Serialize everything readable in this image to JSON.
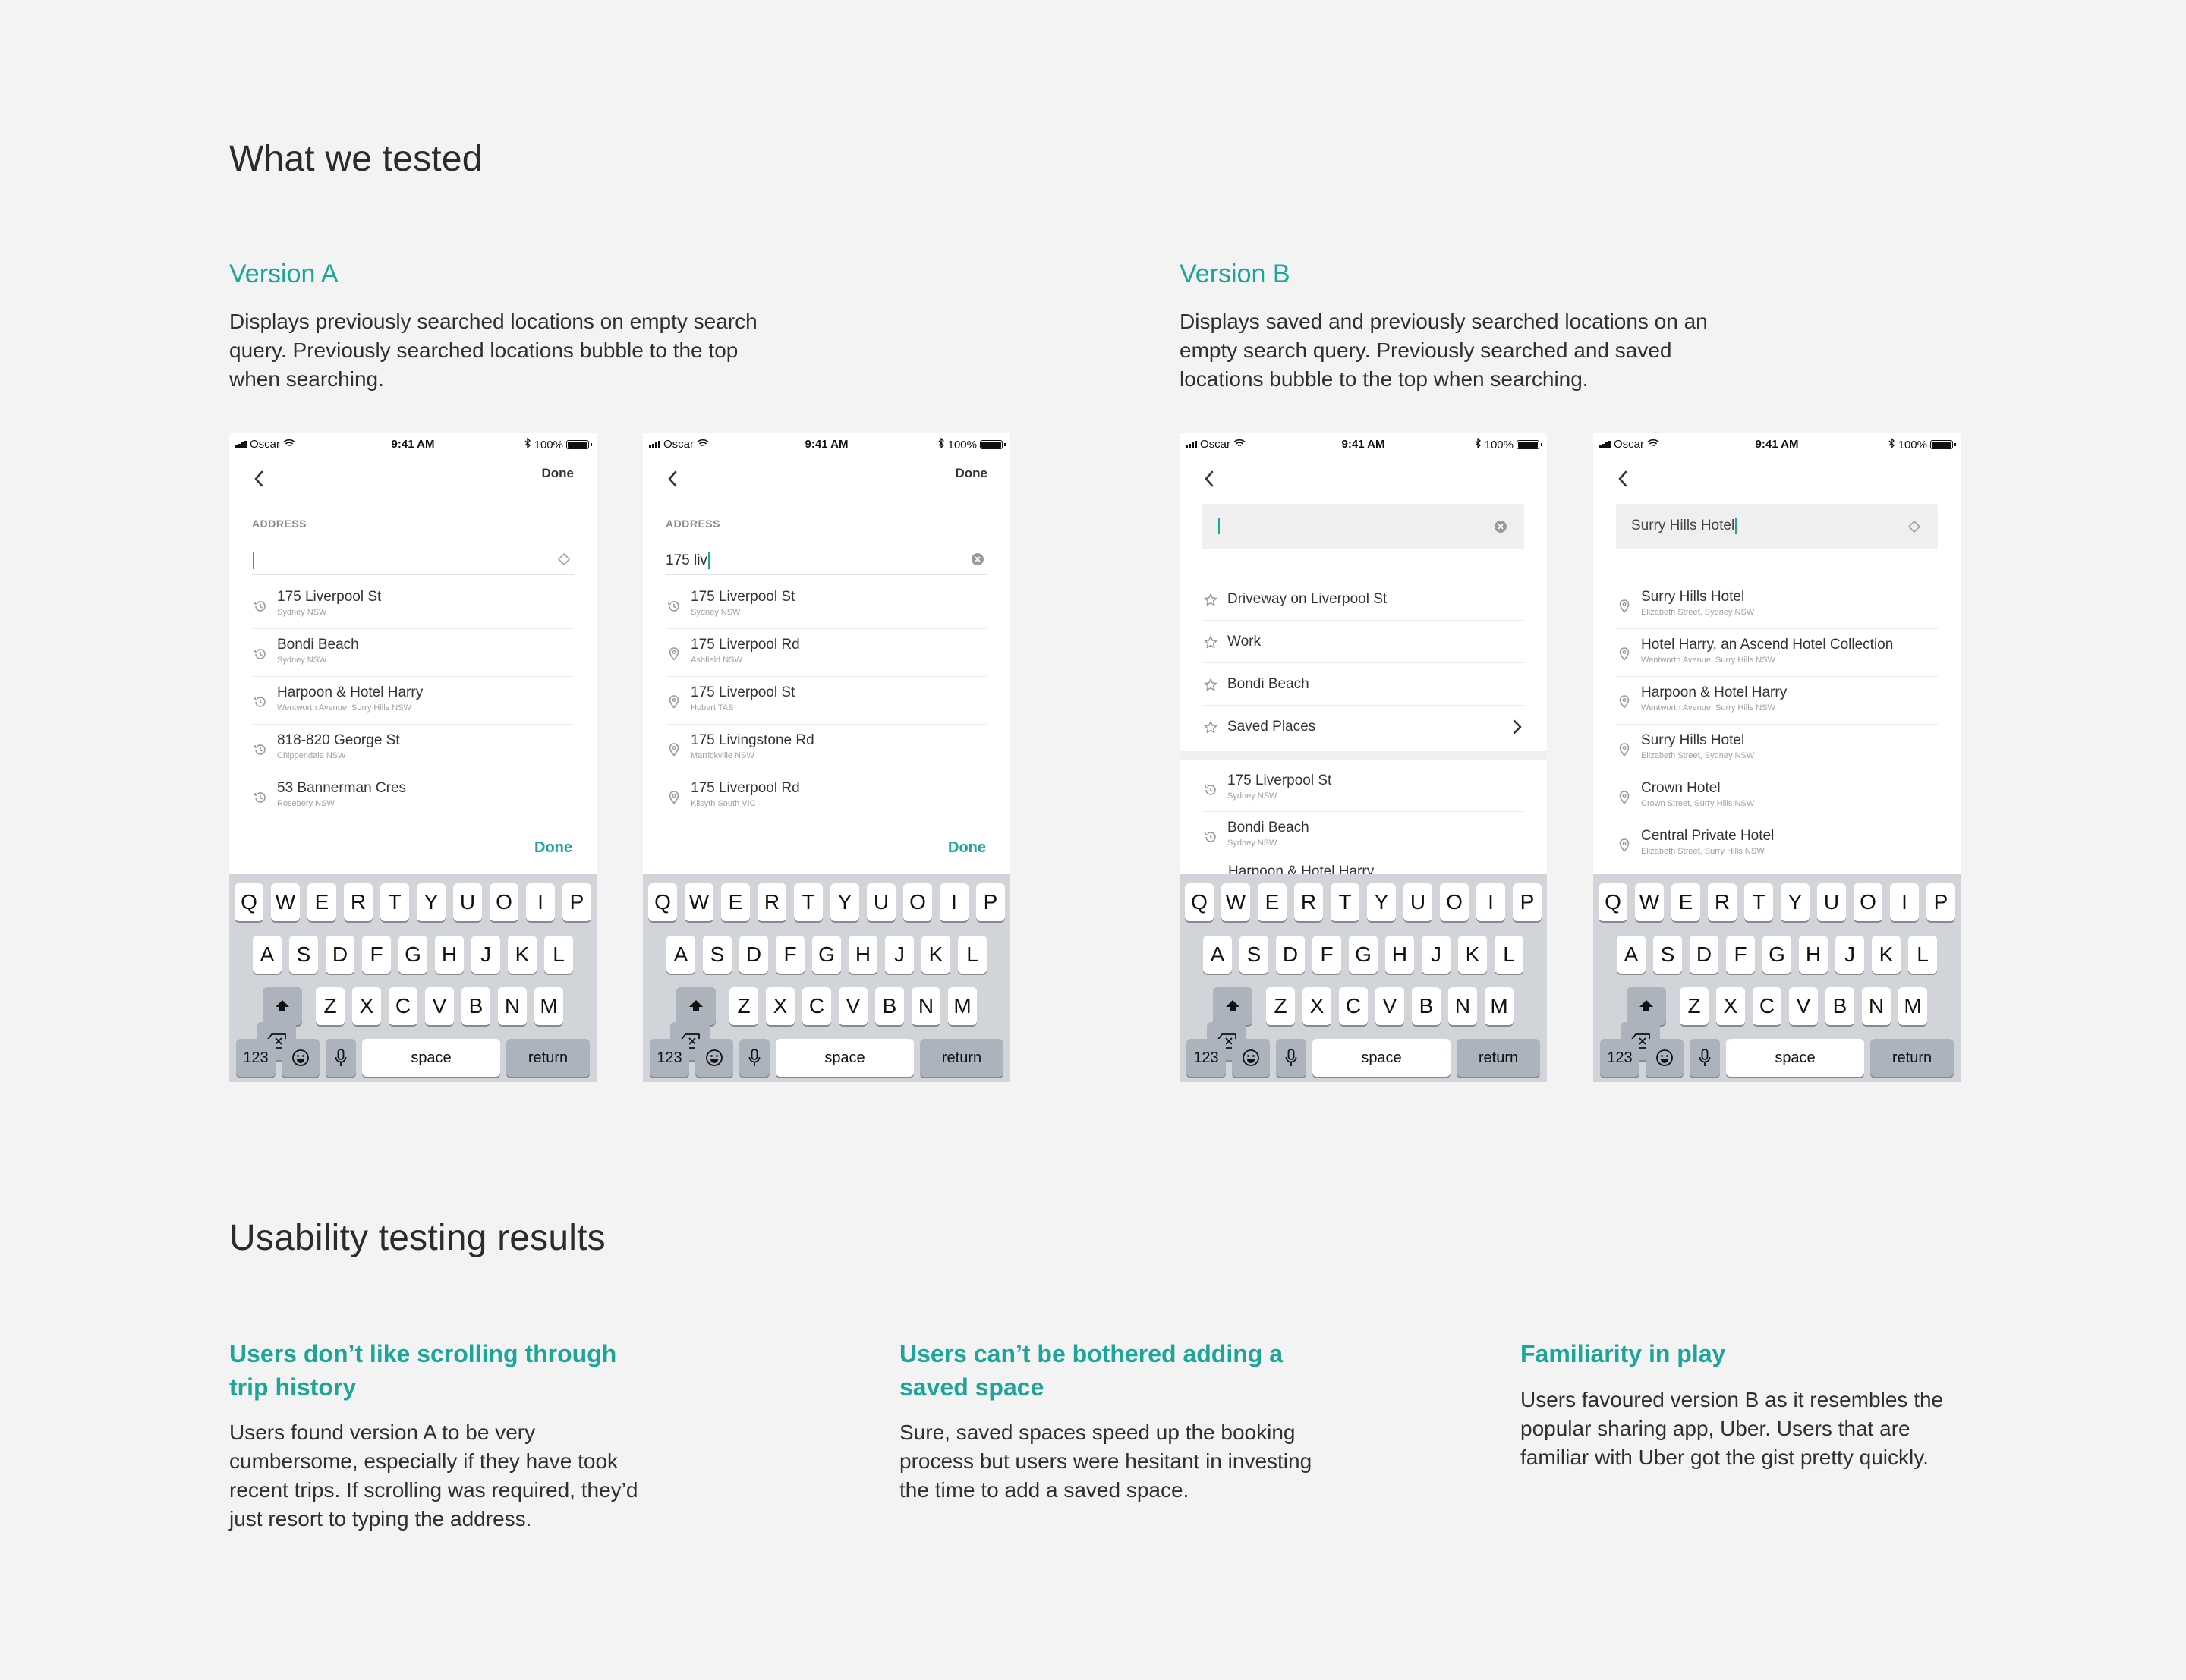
{
  "heading_tested": "What we tested",
  "heading_results": "Usability testing results",
  "version_a": {
    "title": "Version A",
    "description": "Displays previously searched locations on empty search query. Previously searched locations bubble to the top when searching."
  },
  "version_b": {
    "title": "Version B",
    "description": "Displays saved and previously searched locations on an empty search query. Previously searched and saved locations bubble to the top when searching."
  },
  "status_bar": {
    "carrier": "Oscar",
    "time": "9:41 AM",
    "battery": "100%"
  },
  "phones": [
    {
      "nav_done": "Done",
      "address_label": "ADDRESS",
      "field_value": "",
      "kb_done": "Done",
      "results": [
        {
          "title": "175 Liverpool St",
          "subtitle": "Sydney NSW",
          "icon": "history-icon"
        },
        {
          "title": "Bondi Beach",
          "subtitle": "Sydney NSW",
          "icon": "history-icon"
        },
        {
          "title": "Harpoon & Hotel Harry",
          "subtitle": "Wentworth Avenue, Surry Hills NSW",
          "icon": "history-icon"
        },
        {
          "title": "818-820 George St",
          "subtitle": "Chippendale NSW",
          "icon": "history-icon"
        },
        {
          "title": "53 Bannerman Cres",
          "subtitle": "Rosebery NSW",
          "icon": "history-icon"
        }
      ]
    },
    {
      "nav_done": "Done",
      "address_label": "ADDRESS",
      "field_value": "175 liv",
      "kb_done": "Done",
      "results": [
        {
          "title": "175 Liverpool St",
          "subtitle": "Sydney NSW",
          "icon": "history-icon"
        },
        {
          "title": "175 Liverpool Rd",
          "subtitle": "Ashfield NSW",
          "icon": "pin-icon"
        },
        {
          "title": "175 Liverpool St",
          "subtitle": "Hobart TAS",
          "icon": "pin-icon"
        },
        {
          "title": "175 Livingstone Rd",
          "subtitle": "Marrickville NSW",
          "icon": "pin-icon"
        },
        {
          "title": "175 Liverpool Rd",
          "subtitle": "Kilsyth South VIC",
          "icon": "pin-icon"
        }
      ]
    },
    {
      "field_value": "",
      "saved": [
        {
          "title": "Driveway on Liverpool St"
        },
        {
          "title": "Work"
        },
        {
          "title": "Bondi Beach"
        },
        {
          "title": "Saved Places"
        }
      ],
      "results": [
        {
          "title": "175 Liverpool St",
          "subtitle": "Sydney NSW",
          "icon": "history-icon"
        },
        {
          "title": "Bondi Beach",
          "subtitle": "Sydney NSW",
          "icon": "history-icon"
        }
      ],
      "partial_row": "Harpoon & Hotel Harry"
    },
    {
      "field_value": "Surry Hills Hotel",
      "results": [
        {
          "title": "Surry Hills Hotel",
          "subtitle": "Elizabeth Street, Sydney NSW",
          "icon": "pin-icon"
        },
        {
          "title": "Hotel Harry, an Ascend Hotel Collection",
          "subtitle": "Wentworth Avenue, Surry Hills NSW",
          "icon": "pin-icon"
        },
        {
          "title": "Harpoon & Hotel Harry",
          "subtitle": "Wentworth Avenue, Surry Hills NSW",
          "icon": "pin-icon"
        },
        {
          "title": "Surry Hills Hotel",
          "subtitle": "Elizabeth Street, Sydney NSW",
          "icon": "pin-icon"
        },
        {
          "title": "Crown Hotel",
          "subtitle": "Crown Street, Surry Hills NSW",
          "icon": "pin-icon"
        },
        {
          "title": "Central Private Hotel",
          "subtitle": "Elizabeth Street, Surry Hills NSW",
          "icon": "pin-icon"
        }
      ]
    }
  ],
  "keyboard": {
    "row1": [
      "Q",
      "W",
      "E",
      "R",
      "T",
      "Y",
      "U",
      "O",
      "I",
      "P"
    ],
    "row2": [
      "A",
      "S",
      "D",
      "F",
      "G",
      "H",
      "J",
      "K",
      "L"
    ],
    "row3": [
      "Z",
      "X",
      "C",
      "V",
      "B",
      "N",
      "M"
    ],
    "num": "123",
    "space": "space",
    "return": "return"
  },
  "findings": [
    {
      "title": "Users don’t like scrolling through trip history",
      "body": "Users found version A to be very cumbersome, especially if they have took recent trips. If scrolling was required, they’d just resort to typing the address."
    },
    {
      "title": "Users can’t be bothered adding a saved space",
      "body": "Sure, saved spaces speed up the booking process but users were hesitant in investing the time to add a saved space."
    },
    {
      "title": "Familiarity in play",
      "body": "Users favoured version B as it resembles the popular sharing app, Uber. Users that are familiar with Uber got the gist pretty quickly."
    }
  ],
  "colors": {
    "accent": "#1ea59a",
    "background": "#f3f3f3",
    "keyboard": "#d1d4d9"
  }
}
